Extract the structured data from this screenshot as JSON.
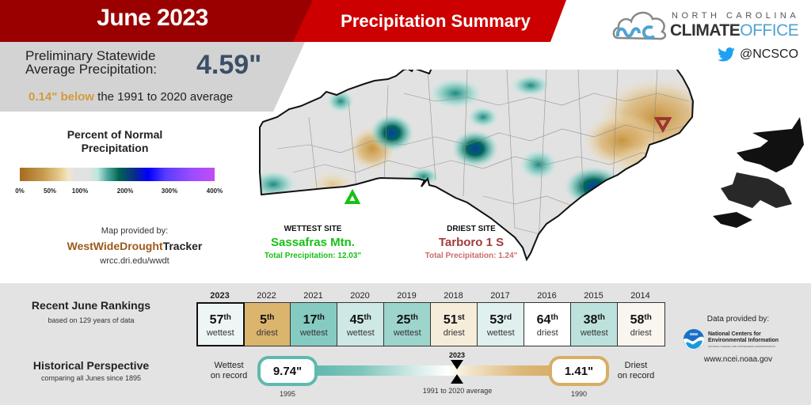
{
  "header": {
    "month": "June 2023",
    "title": "Precipitation Summary"
  },
  "summary": {
    "label_line1": "Preliminary Statewide",
    "label_line2": "Average Precipitation:",
    "value": "4.59\"",
    "diff_value": "0.14\" below",
    "diff_rest": " the 1991 to 2020 average"
  },
  "logo": {
    "subtitle": "NORTH CAROLINA",
    "main_bold": "CLIMATE",
    "main_light": "OFFICE",
    "twitter_handle": "@NCSCO"
  },
  "legend": {
    "title_line1": "Percent of Normal",
    "title_line2": "Precipitation",
    "ticks": [
      "0%",
      "50%",
      "100%",
      "200%",
      "300%",
      "400%"
    ],
    "colors": {
      "dry": "#a56b20",
      "normal": "#e2e2e2",
      "wet": "#006450",
      "very_wet": "#0000ff",
      "extreme": "#c24cf3"
    }
  },
  "map_credit": {
    "label": "Map provided by:",
    "brand_part1": "WestWideDrought",
    "brand_part2": "Tracker",
    "url": "wrcc.dri.edu/wwdt"
  },
  "sites": {
    "wettest": {
      "heading": "WETTEST SITE",
      "name": "Sassafras Mtn.",
      "total": "Total Precipitation: 12.03\"",
      "color": "#16c116"
    },
    "driest": {
      "heading": "DRIEST SITE",
      "name": "Tarboro 1 S",
      "total": "Total Precipitation: 1.24\"",
      "color": "#a33b3b"
    }
  },
  "rankings": {
    "title": "Recent June Rankings",
    "subtitle": "based on 129 years of data",
    "items": [
      {
        "year": "2023",
        "num": "57",
        "suffix": "th",
        "type": "wettest",
        "color": "#eef6f5",
        "current": true
      },
      {
        "year": "2022",
        "num": "5",
        "suffix": "th",
        "type": "driest",
        "color": "#dbb46e",
        "current": false
      },
      {
        "year": "2021",
        "num": "17",
        "suffix": "th",
        "type": "wettest",
        "color": "#86cbc2",
        "current": false
      },
      {
        "year": "2020",
        "num": "45",
        "suffix": "th",
        "type": "wettest",
        "color": "#cde8e5",
        "current": false
      },
      {
        "year": "2019",
        "num": "25",
        "suffix": "th",
        "type": "wettest",
        "color": "#9dd4cc",
        "current": false
      },
      {
        "year": "2018",
        "num": "51",
        "suffix": "st",
        "type": "driest",
        "color": "#f5ecda",
        "current": false
      },
      {
        "year": "2017",
        "num": "53",
        "suffix": "rd",
        "type": "wettest",
        "color": "#dff0ee",
        "current": false
      },
      {
        "year": "2016",
        "num": "64",
        "suffix": "th",
        "type": "driest",
        "color": "#ffffff",
        "current": false
      },
      {
        "year": "2015",
        "num": "38",
        "suffix": "th",
        "type": "wettest",
        "color": "#bde2dd",
        "current": false
      },
      {
        "year": "2014",
        "num": "58",
        "suffix": "th",
        "type": "driest",
        "color": "#faf5ee",
        "current": false
      }
    ]
  },
  "historical": {
    "title": "Historical Perspective",
    "subtitle": "comparing all Junes since 1895",
    "wettest_label_line1": "Wettest",
    "wettest_label_line2": "on record",
    "wettest_value": "9.74\"",
    "wettest_year": "1995",
    "driest_label_line1": "Driest",
    "driest_label_line2": "on record",
    "driest_value": "1.41\"",
    "driest_year": "1990",
    "marker_year": "2023",
    "average_caption": "1991 to 2020 average"
  },
  "data_credit": {
    "label": "Data provided by:",
    "org_line1": "National Centers for",
    "org_line2": "Environmental Information",
    "org_tiny": "NATIONAL OCEANIC AND ATMOSPHERIC ADMINISTRATION",
    "url": "www.ncei.noaa.gov"
  }
}
